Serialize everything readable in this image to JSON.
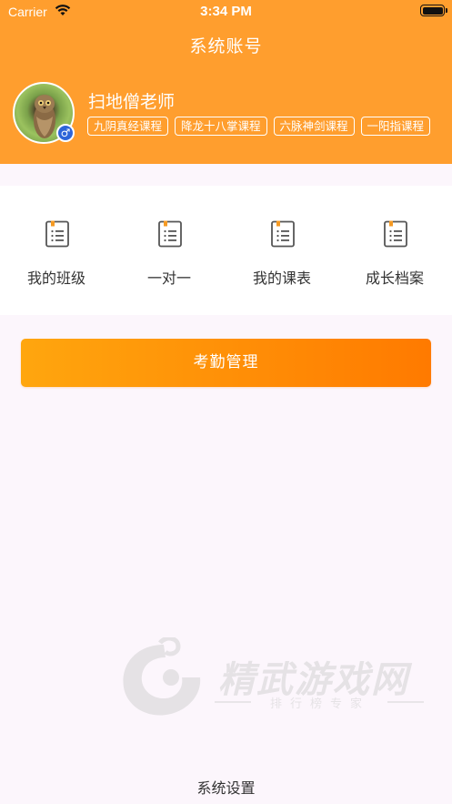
{
  "status_bar": {
    "carrier": "Carrier",
    "time": "3:34 PM",
    "wifi_icon": "wifi-icon",
    "battery_icon": "battery-icon",
    "battery_level": 1.0
  },
  "header": {
    "title": "系统账号",
    "background_color": "#FF9E2E"
  },
  "profile": {
    "name": "扫地僧老师",
    "avatar": "owl-avatar",
    "gender_icon": "male-icon",
    "gender_symbol": "♂",
    "courses": [
      "九阴真经课程",
      "降龙十八掌课程",
      "六脉神剑课程",
      "一阳指课程"
    ]
  },
  "menu": {
    "items": [
      {
        "label": "我的班级",
        "icon": "document-list-icon"
      },
      {
        "label": "一对一",
        "icon": "document-list-icon"
      },
      {
        "label": "我的课表",
        "icon": "document-list-icon"
      },
      {
        "label": "成长档案",
        "icon": "document-list-icon"
      }
    ]
  },
  "attendance_button": {
    "label": "考勤管理",
    "gradient": [
      "#FFA60E",
      "#FF7A00"
    ]
  },
  "watermark": {
    "title": "精武游戏网",
    "subtitle": "排行榜专家"
  },
  "settings": {
    "label": "系统设置"
  }
}
